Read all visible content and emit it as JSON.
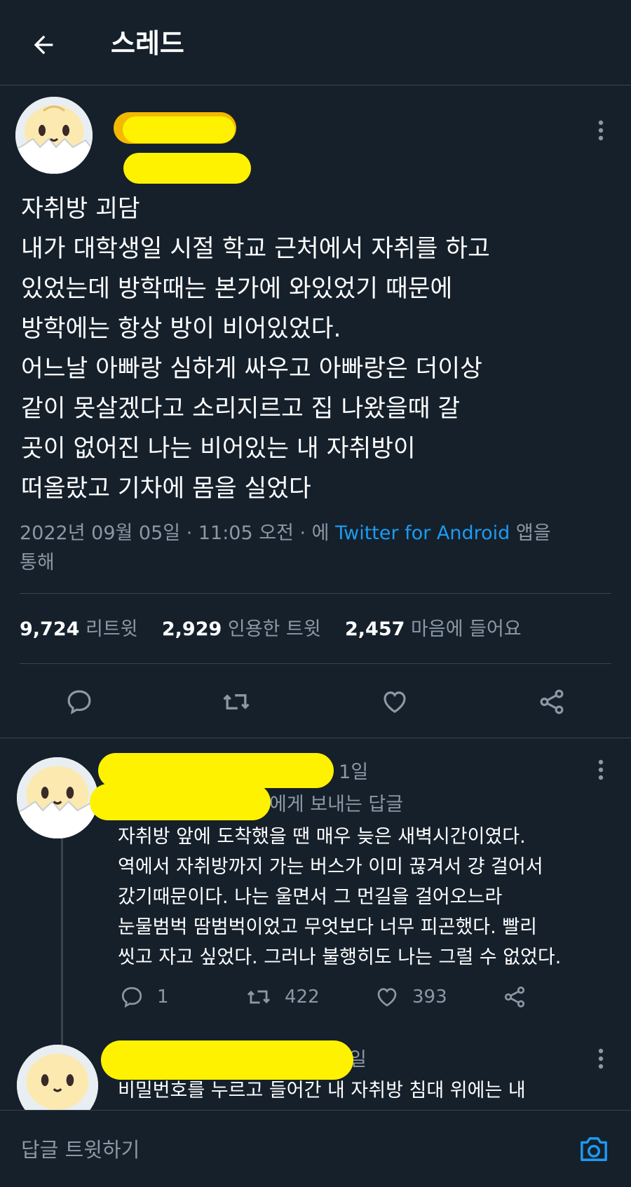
{
  "header": {
    "title": "스레드"
  },
  "tweet": {
    "title_line": "자취방 괴담",
    "lines": [
      "내가 대학생일 시절 학교 근처에서 자취를 하고",
      "있었는데 방학때는 본가에 와있었기 때문에",
      "방학에는 항상 방이 비어있었다.",
      "어느날 아빠랑 심하게 싸우고 아빠랑은 더이상",
      "같이 못살겠다고 소리지르고 집 나왔을때 갈",
      "곳이 없어진 나는 비어있는 내 자취방이",
      "떠올랐고 기차에 몸을 실었다"
    ],
    "meta_prefix": "2022년 09월 05일 · 11:05 오전 · 에 ",
    "meta_source": "Twitter for Android",
    "meta_suffix": " 앱을",
    "meta_line2": "통해",
    "stats": {
      "retweets": "9,724",
      "retweets_label": "리트윗",
      "quotes": "2,929",
      "quotes_label": "인용한 트윗",
      "likes": "2,457",
      "likes_label": "마음에 들어요"
    }
  },
  "reply1": {
    "time": "· 1일",
    "replying_to": "에게 보내는 답글",
    "lines": [
      "자취방 앞에 도착했을 땐 매우 늦은 새벽시간이였다.",
      "역에서 자취방까지 가는 버스가 이미 끊겨서 걍 걸어서",
      "갔기때문이다. 나는 울면서 그 먼길을 걸어오느라",
      "눈물범벅 땀범벅이었고 무엇보다 너무 피곤했다. 빨리",
      "씻고 자고 싶었다. 그러나 불행히도 나는 그럴 수 없었다."
    ],
    "replies": "1",
    "retweets": "422",
    "likes": "393"
  },
  "reply2": {
    "time": "일",
    "lines": [
      "비밀번호를 누르고 들어간 내 자취방 침대 위에는 내"
    ]
  },
  "composer": {
    "placeholder": "답글 트윗하기"
  },
  "colors": {
    "background": "#15202b",
    "accent": "#1d9bf0",
    "muted": "#8b98a5",
    "redaction": "#fff200"
  }
}
